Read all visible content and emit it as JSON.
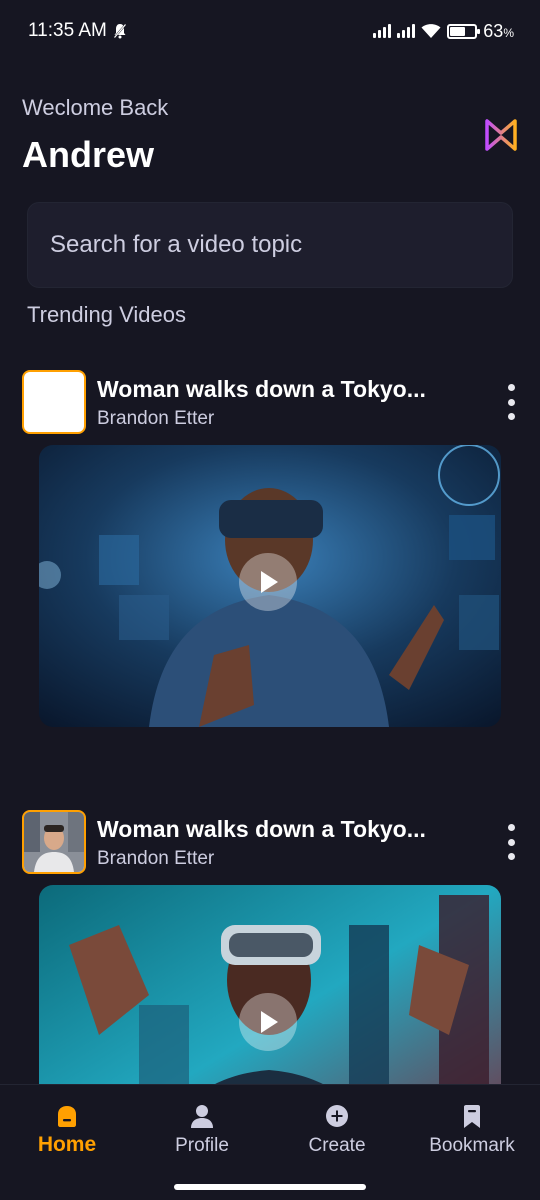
{
  "status_bar": {
    "time": "11:35 AM",
    "battery": "63",
    "battery_unit": "%",
    "battery_level": 0.63
  },
  "header": {
    "welcome_text": "Weclome Back",
    "username": "Andrew"
  },
  "search": {
    "placeholder": "Search for a video topic"
  },
  "section": {
    "title": "Trending Videos"
  },
  "videos": [
    {
      "title": "Woman walks down a Tokyo...",
      "creator": "Brandon Etter"
    },
    {
      "title": "Woman walks down a Tokyo...",
      "creator": "Brandon Etter"
    }
  ],
  "nav": {
    "items": [
      {
        "label": "Home",
        "icon": "home-icon"
      },
      {
        "label": "Profile",
        "icon": "profile-icon"
      },
      {
        "label": "Create",
        "icon": "plus-icon"
      },
      {
        "label": "Bookmark",
        "icon": "bookmark-icon"
      }
    ]
  },
  "colors": {
    "background": "#161622",
    "accent": "#ffa001",
    "surface": "#1e1e2d",
    "muted_text": "#cdcde0"
  }
}
